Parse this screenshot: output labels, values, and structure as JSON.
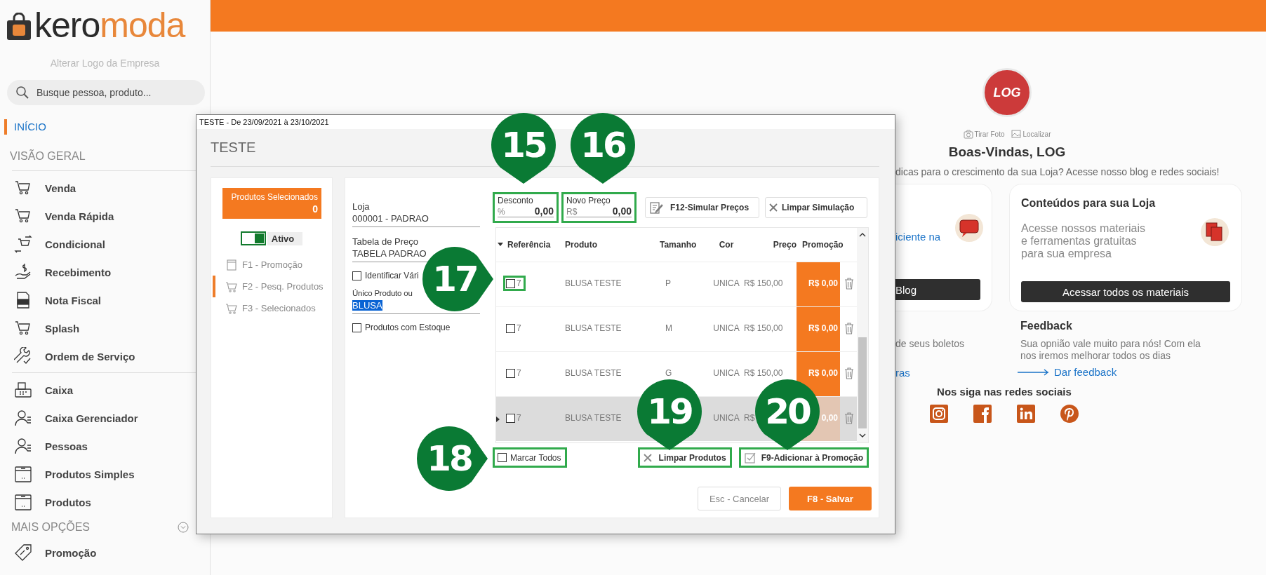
{
  "sidebar": {
    "logo": {
      "first": "kero",
      "second": "moda"
    },
    "change_logo": "Alterar Logo da Empresa",
    "search": {
      "placeholder": "Busque pessoa, produto..."
    },
    "home_link": {
      "label": "INÍCIO",
      "selected": true
    },
    "section_heading": "VISÃO GERAL",
    "groups": [
      [
        {
          "kind": "cart",
          "label": "Venda"
        },
        {
          "kind": "cart",
          "label": "Venda Rápida"
        },
        {
          "kind": "swap",
          "label": "Condicional"
        },
        {
          "kind": "money",
          "label": "Recebimento"
        },
        {
          "kind": "doc",
          "label": "Nota Fiscal"
        },
        {
          "kind": "cart",
          "label": "Splash"
        },
        {
          "kind": "wrench",
          "label": "Ordem de Serviço"
        }
      ],
      [
        {
          "kind": "register",
          "label": "Caixa"
        },
        {
          "kind": "person",
          "label": "Caixa Gerenciador"
        },
        {
          "kind": "person",
          "label": "Pessoas"
        },
        {
          "kind": "box",
          "label": "Produtos Simples"
        },
        {
          "kind": "box",
          "label": "Produtos"
        }
      ]
    ],
    "more": {
      "label": "MAIS OPÇÕES",
      "expanded": false
    },
    "more_items": [
      {
        "kind": "tag",
        "label": "Promoção"
      }
    ]
  },
  "home": {
    "avatar": {
      "text": "LOG"
    },
    "photo_actions": [
      {
        "kind": "camera",
        "label": "Tirar Foto"
      },
      {
        "kind": "image",
        "label": "Localizar"
      }
    ],
    "welcome": "Boas-Vindas, LOG",
    "tagline": "dicas para o crescimento da sua Loja? Acesse nosso blog e redes sociais!",
    "card_left": {
      "link": "iciente na",
      "button": "Blog"
    },
    "card_right": {
      "title": "Conteúdos para sua Loja",
      "text": "Acesse nossos materiais e ferramentas gratuitas para sua empresa",
      "button": "Acessar todos os materiais"
    },
    "left_text": "de seus boletos",
    "left_link": "ras",
    "feedback": {
      "title": "Feedback",
      "text": "Sua opnião vale muito para nós! Com ela nos iremos melhorar todos os dias",
      "link": "Dar feedback"
    },
    "social": {
      "title": "Nos siga nas redes sociais",
      "icons": [
        {
          "kind": "instagram"
        },
        {
          "kind": "facebook"
        },
        {
          "kind": "linkedin"
        },
        {
          "kind": "pinterest"
        }
      ]
    }
  },
  "dialog": {
    "title": "TESTE - De 23/09/2021 à 23/10/2021",
    "heading": "TESTE",
    "selected_products": {
      "label": "Produtos Selecionados",
      "count": "0"
    },
    "active_toggle": {
      "label": "Ativo",
      "on": true
    },
    "steps": [
      {
        "kind": "calendar",
        "label": "F1 - Promoção",
        "selected": false
      },
      {
        "kind": "cart",
        "label": "F2 - Pesq. Produtos",
        "selected": true
      },
      {
        "kind": "cart",
        "label": "F3 - Selecionados",
        "selected": false
      }
    ],
    "form": {
      "store": {
        "label": "Loja",
        "value": "000001 - PADRAO"
      },
      "price_table": {
        "label": "Tabela de Preço",
        "value": "TABELA PADRAO"
      },
      "identify": {
        "label": "Identificar Vári",
        "checked": false
      },
      "product": {
        "label": "Único Produto ou",
        "value": "BLUSA",
        "selected": true
      },
      "stock": {
        "label": "Produtos com Estoque",
        "checked": false
      }
    },
    "discount": {
      "label": "Desconto",
      "prefix": "%",
      "value": "0,00",
      "highlighted": true
    },
    "new_price": {
      "label": "Novo Preço",
      "prefix": "R$",
      "value": "0,00",
      "highlighted": true
    },
    "simulate_button": "F12-Simular Preços",
    "clear_simulation_button": "Limpar Simulação",
    "table": {
      "columns": [
        "Referência",
        "Produto",
        "Tamanho",
        "Cor",
        "Preço",
        "Promoção"
      ],
      "rows": [
        {
          "checked": false,
          "highlighted": true,
          "selected": false,
          "reference": "7",
          "product": "BLUSA TESTE",
          "size": "P",
          "cor": "UNICA",
          "price": "R$ 150,00",
          "promotion": "R$ 0,00"
        },
        {
          "checked": false,
          "highlighted": false,
          "selected": false,
          "reference": "7",
          "product": "BLUSA TESTE",
          "size": "M",
          "cor": "UNICA",
          "price": "R$ 150,00",
          "promotion": "R$ 0,00"
        },
        {
          "checked": false,
          "highlighted": false,
          "selected": false,
          "reference": "7",
          "product": "BLUSA TESTE",
          "size": "G",
          "cor": "UNICA",
          "price": "R$ 150,00",
          "promotion": "R$ 0,00"
        },
        {
          "checked": false,
          "highlighted": false,
          "selected": true,
          "reference": "7",
          "product": "BLUSA TESTE",
          "cor": "UNICA",
          "price": "R$",
          "promotion": "0,00"
        }
      ]
    },
    "mark_all": {
      "label": "Marcar Todos",
      "checked": false,
      "highlighted": true
    },
    "clear_products_button": {
      "label": "Limpar Produtos",
      "highlighted": true
    },
    "add_button": {
      "label": "F9-Adicionar à Promoção",
      "highlighted": true
    },
    "cancel_button": "Esc - Cancelar",
    "save_button": "F8 - Salvar"
  },
  "callouts": [
    {
      "number": "15"
    },
    {
      "number": "16"
    },
    {
      "number": "17"
    },
    {
      "number": "18"
    },
    {
      "number": "19"
    },
    {
      "number": "20"
    }
  ]
}
